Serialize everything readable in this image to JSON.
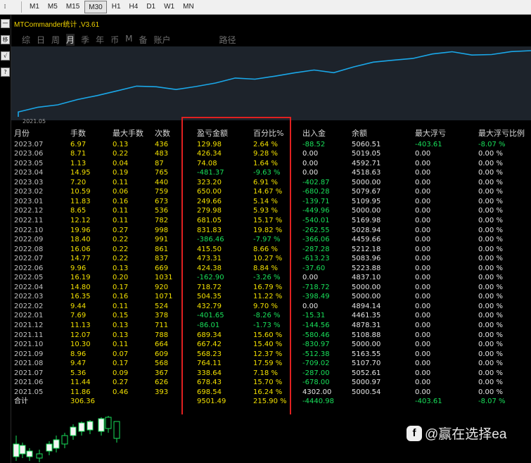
{
  "toolbar": {
    "timeframes": [
      {
        "label": "M1",
        "active": false
      },
      {
        "label": "M5",
        "active": false
      },
      {
        "label": "M15",
        "active": false
      },
      {
        "label": "M30",
        "active": true
      },
      {
        "label": "H1",
        "active": false
      },
      {
        "label": "H4",
        "active": false
      },
      {
        "label": "D1",
        "active": false
      },
      {
        "label": "W1",
        "active": false
      },
      {
        "label": "MN",
        "active": false
      }
    ]
  },
  "left_toolbar": [
    "一",
    "移",
    "√",
    "?"
  ],
  "panel": {
    "title": "MTCommander统计 ,V3.61",
    "tabs": [
      {
        "label": "综",
        "active": false
      },
      {
        "label": "日",
        "active": false
      },
      {
        "label": "周",
        "active": false
      },
      {
        "label": "月",
        "active": true
      },
      {
        "label": "季",
        "active": false
      },
      {
        "label": "年",
        "active": false
      },
      {
        "label": "币",
        "active": false
      },
      {
        "label": "M",
        "active": false
      },
      {
        "label": "备",
        "active": false
      },
      {
        "label": "账户",
        "active": false
      },
      {
        "label": "路径",
        "active": false
      }
    ],
    "chart_start_label": "2021.05",
    "line_color": "#1aa7e8"
  },
  "chart_data": {
    "type": "line",
    "x": [
      "2021.05",
      "2021.06",
      "2021.07",
      "2021.08",
      "2021.09",
      "2021.10",
      "2021.11",
      "2021.12",
      "2022.01",
      "2022.02",
      "2022.03",
      "2022.04",
      "2022.05",
      "2022.06",
      "2022.07",
      "2022.08",
      "2022.09",
      "2022.10",
      "2022.11",
      "2022.12",
      "2023.01",
      "2023.02",
      "2023.03",
      "2023.04",
      "2023.05",
      "2023.06",
      "2023.07"
    ],
    "series": [
      {
        "values": [
          698.54,
          1376.97,
          1715.61,
          2479.72,
          3047.95,
          3715.37,
          4404.71,
          4318.7,
          3917.05,
          4349.84,
          4854.19,
          5572.91,
          5410.01,
          5834.39,
          6307.7,
          6723.2,
          6336.74,
          7168.57,
          7849.62,
          8129.6,
          8379.26,
          9029.26,
          9352.46,
          8871.09,
          8945.17,
          9371.51,
          9501.49
        ]
      }
    ]
  },
  "table": {
    "headers": [
      "月份",
      "手数",
      "最大手数",
      "次数",
      "盈亏金额",
      "百分比%",
      "出入金",
      "余额",
      "最大浮亏",
      "最大浮亏比例"
    ],
    "rows": [
      {
        "month": "2023.07",
        "lots": "6.97",
        "max_lots": "0.13",
        "count": "436",
        "pnl": "129.98",
        "pct": "2.64 %",
        "flow": "-88.52",
        "balance": "5060.51",
        "max_dd": "-403.61",
        "max_dd_pct": "-8.07 %"
      },
      {
        "month": "2023.06",
        "lots": "8.71",
        "max_lots": "0.22",
        "count": "483",
        "pnl": "426.34",
        "pct": "9.28 %",
        "flow": "0.00",
        "balance": "5019.05",
        "max_dd": "0.00",
        "max_dd_pct": "0.00 %"
      },
      {
        "month": "2023.05",
        "lots": "1.13",
        "max_lots": "0.04",
        "count": "87",
        "pnl": "74.08",
        "pct": "1.64 %",
        "flow": "0.00",
        "balance": "4592.71",
        "max_dd": "0.00",
        "max_dd_pct": "0.00 %"
      },
      {
        "month": "2023.04",
        "lots": "14.95",
        "max_lots": "0.19",
        "count": "765",
        "pnl": "-481.37",
        "pct": "-9.63 %",
        "flow": "0.00",
        "balance": "4518.63",
        "max_dd": "0.00",
        "max_dd_pct": "0.00 %"
      },
      {
        "month": "2023.03",
        "lots": "7.20",
        "max_lots": "0.11",
        "count": "440",
        "pnl": "323.20",
        "pct": "6.91 %",
        "flow": "-402.87",
        "balance": "5000.00",
        "max_dd": "0.00",
        "max_dd_pct": "0.00 %"
      },
      {
        "month": "2023.02",
        "lots": "10.59",
        "max_lots": "0.06",
        "count": "759",
        "pnl": "650.00",
        "pct": "14.67 %",
        "flow": "-680.28",
        "balance": "5079.67",
        "max_dd": "0.00",
        "max_dd_pct": "0.00 %"
      },
      {
        "month": "2023.01",
        "lots": "11.83",
        "max_lots": "0.16",
        "count": "673",
        "pnl": "249.66",
        "pct": "5.14 %",
        "flow": "-139.71",
        "balance": "5109.95",
        "max_dd": "0.00",
        "max_dd_pct": "0.00 %"
      },
      {
        "month": "2022.12",
        "lots": "8.65",
        "max_lots": "0.11",
        "count": "536",
        "pnl": "279.98",
        "pct": "5.93 %",
        "flow": "-449.96",
        "balance": "5000.00",
        "max_dd": "0.00",
        "max_dd_pct": "0.00 %"
      },
      {
        "month": "2022.11",
        "lots": "12.12",
        "max_lots": "0.11",
        "count": "782",
        "pnl": "681.05",
        "pct": "15.17 %",
        "flow": "-540.01",
        "balance": "5169.98",
        "max_dd": "0.00",
        "max_dd_pct": "0.00 %"
      },
      {
        "month": "2022.10",
        "lots": "19.96",
        "max_lots": "0.27",
        "count": "998",
        "pnl": "831.83",
        "pct": "19.82 %",
        "flow": "-262.55",
        "balance": "5028.94",
        "max_dd": "0.00",
        "max_dd_pct": "0.00 %"
      },
      {
        "month": "2022.09",
        "lots": "18.40",
        "max_lots": "0.22",
        "count": "991",
        "pnl": "-386.46",
        "pct": "-7.97 %",
        "flow": "-366.06",
        "balance": "4459.66",
        "max_dd": "0.00",
        "max_dd_pct": "0.00 %"
      },
      {
        "month": "2022.08",
        "lots": "16.06",
        "max_lots": "0.22",
        "count": "861",
        "pnl": "415.50",
        "pct": "8.66 %",
        "flow": "-287.28",
        "balance": "5212.18",
        "max_dd": "0.00",
        "max_dd_pct": "0.00 %"
      },
      {
        "month": "2022.07",
        "lots": "14.77",
        "max_lots": "0.22",
        "count": "837",
        "pnl": "473.31",
        "pct": "10.27 %",
        "flow": "-613.23",
        "balance": "5083.96",
        "max_dd": "0.00",
        "max_dd_pct": "0.00 %"
      },
      {
        "month": "2022.06",
        "lots": "9.96",
        "max_lots": "0.13",
        "count": "669",
        "pnl": "424.38",
        "pct": "8.84 %",
        "flow": "-37.60",
        "balance": "5223.88",
        "max_dd": "0.00",
        "max_dd_pct": "0.00 %"
      },
      {
        "month": "2022.05",
        "lots": "16.19",
        "max_lots": "0.20",
        "count": "1031",
        "pnl": "-162.90",
        "pct": "-3.26 %",
        "flow": "0.00",
        "balance": "4837.10",
        "max_dd": "0.00",
        "max_dd_pct": "0.00 %"
      },
      {
        "month": "2022.04",
        "lots": "14.80",
        "max_lots": "0.17",
        "count": "920",
        "pnl": "718.72",
        "pct": "16.79 %",
        "flow": "-718.72",
        "balance": "5000.00",
        "max_dd": "0.00",
        "max_dd_pct": "0.00 %"
      },
      {
        "month": "2022.03",
        "lots": "16.35",
        "max_lots": "0.16",
        "count": "1071",
        "pnl": "504.35",
        "pct": "11.22 %",
        "flow": "-398.49",
        "balance": "5000.00",
        "max_dd": "0.00",
        "max_dd_pct": "0.00 %"
      },
      {
        "month": "2022.02",
        "lots": "9.44",
        "max_lots": "0.11",
        "count": "524",
        "pnl": "432.79",
        "pct": "9.70 %",
        "flow": "0.00",
        "balance": "4894.14",
        "max_dd": "0.00",
        "max_dd_pct": "0.00 %"
      },
      {
        "month": "2022.01",
        "lots": "7.69",
        "max_lots": "0.15",
        "count": "378",
        "pnl": "-401.65",
        "pct": "-8.26 %",
        "flow": "-15.31",
        "balance": "4461.35",
        "max_dd": "0.00",
        "max_dd_pct": "0.00 %"
      },
      {
        "month": "2021.12",
        "lots": "11.13",
        "max_lots": "0.13",
        "count": "711",
        "pnl": "-86.01",
        "pct": "-1.73 %",
        "flow": "-144.56",
        "balance": "4878.31",
        "max_dd": "0.00",
        "max_dd_pct": "0.00 %"
      },
      {
        "month": "2021.11",
        "lots": "12.07",
        "max_lots": "0.13",
        "count": "788",
        "pnl": "689.34",
        "pct": "15.60 %",
        "flow": "-580.46",
        "balance": "5108.88",
        "max_dd": "0.00",
        "max_dd_pct": "0.00 %"
      },
      {
        "month": "2021.10",
        "lots": "10.30",
        "max_lots": "0.11",
        "count": "664",
        "pnl": "667.42",
        "pct": "15.40 %",
        "flow": "-830.97",
        "balance": "5000.00",
        "max_dd": "0.00",
        "max_dd_pct": "0.00 %"
      },
      {
        "month": "2021.09",
        "lots": "8.96",
        "max_lots": "0.07",
        "count": "609",
        "pnl": "568.23",
        "pct": "12.37 %",
        "flow": "-512.38",
        "balance": "5163.55",
        "max_dd": "0.00",
        "max_dd_pct": "0.00 %"
      },
      {
        "month": "2021.08",
        "lots": "9.47",
        "max_lots": "0.17",
        "count": "568",
        "pnl": "764.11",
        "pct": "17.59 %",
        "flow": "-709.02",
        "balance": "5107.70",
        "max_dd": "0.00",
        "max_dd_pct": "0.00 %"
      },
      {
        "month": "2021.07",
        "lots": "5.36",
        "max_lots": "0.09",
        "count": "367",
        "pnl": "338.64",
        "pct": "7.18 %",
        "flow": "-287.00",
        "balance": "5052.61",
        "max_dd": "0.00",
        "max_dd_pct": "0.00 %"
      },
      {
        "month": "2021.06",
        "lots": "11.44",
        "max_lots": "0.27",
        "count": "626",
        "pnl": "678.43",
        "pct": "15.70 %",
        "flow": "-678.00",
        "balance": "5000.97",
        "max_dd": "0.00",
        "max_dd_pct": "0.00 %"
      },
      {
        "month": "2021.05",
        "lots": "11.86",
        "max_lots": "0.46",
        "count": "393",
        "pnl": "698.54",
        "pct": "16.24 %",
        "flow": "4302.00",
        "balance": "5000.54",
        "max_dd": "0.00",
        "max_dd_pct": "0.00 %"
      }
    ],
    "total": {
      "month": "合计",
      "lots": "306.36",
      "max_lots": "",
      "count": "",
      "pnl": "9501.49",
      "pct": "215.90 %",
      "flow": "-4440.98",
      "balance": "",
      "max_dd": "-403.61",
      "max_dd_pct": "-8.07 %"
    }
  },
  "watermark": {
    "icon": "facebook-like-icon",
    "text": "@赢在选择ea"
  },
  "colors": {
    "positive": "#f2e000",
    "negative": "#19e05a",
    "highlight_box": "#e02020"
  }
}
